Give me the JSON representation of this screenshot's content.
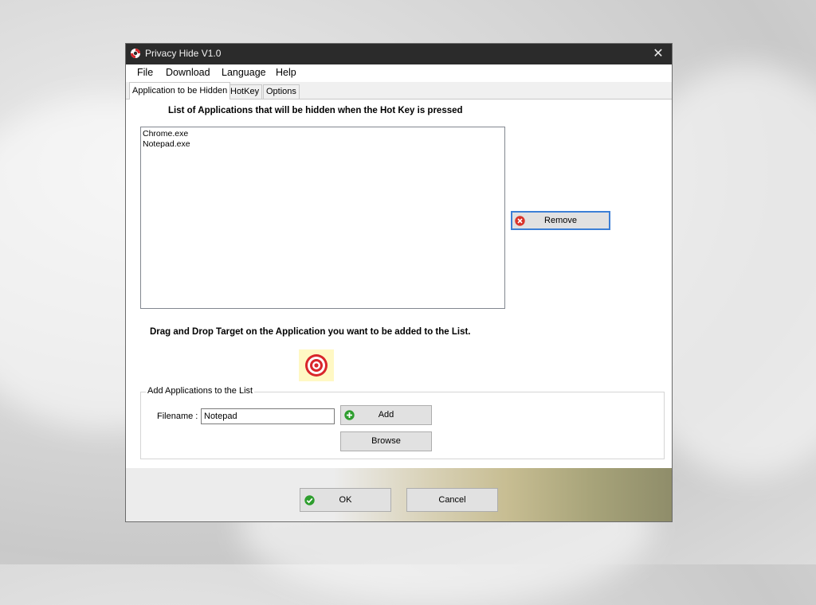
{
  "window": {
    "title": "Privacy Hide V1.0",
    "close_glyph": "✕"
  },
  "menu": {
    "items": [
      "File",
      "Download",
      "Language",
      "Help"
    ]
  },
  "tabs": [
    {
      "label": "Application to be Hidden",
      "active": true
    },
    {
      "label": "HotKey",
      "active": false
    },
    {
      "label": "Options",
      "active": false
    }
  ],
  "apps_list": {
    "heading": "List of Applications that will be hidden when the Hot Key is pressed",
    "items": [
      "Chrome.exe",
      "Notepad.exe"
    ]
  },
  "buttons": {
    "remove": "Remove",
    "add": "Add",
    "browse": "Browse",
    "ok": "OK",
    "cancel": "Cancel"
  },
  "drag_drop": {
    "text": "Drag and Drop Target on the Application you want to be added to the List."
  },
  "add_group": {
    "legend": "Add Applications to the List",
    "filename_label": "Filename :",
    "filename_value": "Notepad"
  },
  "colors": {
    "titlebar": "#2b2b2b",
    "remove_border": "#3c7fd6",
    "remove_icon": "#d9342b",
    "ok_icon": "#2e9e2e",
    "target_red": "#d9262b"
  },
  "icons": {
    "app": "lifebuoy-icon",
    "remove": "remove-x-icon",
    "add": "plus-circle-icon",
    "ok": "check-circle-icon",
    "target": "target-icon"
  }
}
